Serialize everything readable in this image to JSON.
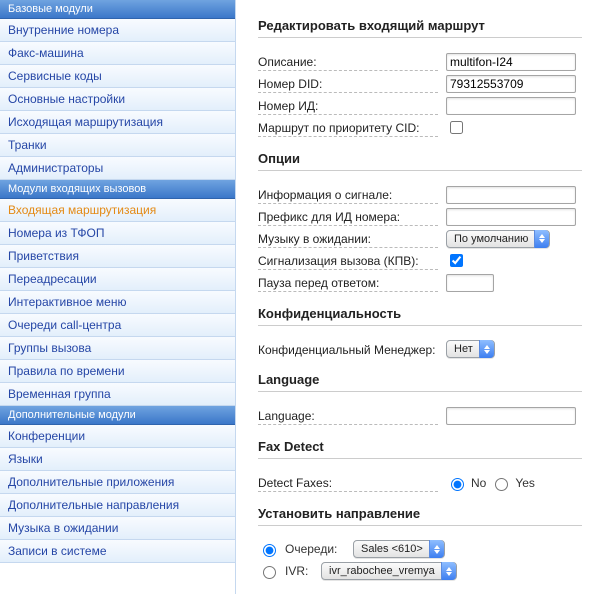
{
  "sidebar": {
    "groups": [
      {
        "header": "Базовые модули",
        "items": [
          {
            "name": "internal-numbers",
            "label": "Внутренние номера"
          },
          {
            "name": "fax-machine",
            "label": "Факс-машина"
          },
          {
            "name": "service-codes",
            "label": "Сервисные коды"
          },
          {
            "name": "main-settings",
            "label": "Основные настройки"
          },
          {
            "name": "outbound-routing",
            "label": "Исходящая маршрутизация"
          },
          {
            "name": "trunks",
            "label": "Транки"
          },
          {
            "name": "administrators",
            "label": "Администраторы"
          }
        ]
      },
      {
        "header": "Модули входящих вызовов",
        "items": [
          {
            "name": "inbound-routing",
            "label": "Входящая маршрутизация",
            "active": true
          },
          {
            "name": "pstn-numbers",
            "label": "Номера из ТФОП"
          },
          {
            "name": "greetings",
            "label": "Приветствия"
          },
          {
            "name": "call-forwarding",
            "label": "Переадресации"
          },
          {
            "name": "ivr-menu",
            "label": "Интерактивное меню"
          },
          {
            "name": "call-center-queues",
            "label": "Очереди call-центра"
          },
          {
            "name": "ring-groups",
            "label": "Группы вызова"
          },
          {
            "name": "time-conditions",
            "label": "Правила по времени"
          },
          {
            "name": "time-groups",
            "label": "Временная группа"
          }
        ]
      },
      {
        "header": "Дополнительные модули",
        "items": [
          {
            "name": "conferences",
            "label": "Конференции"
          },
          {
            "name": "languages",
            "label": "Языки"
          },
          {
            "name": "additional-apps",
            "label": "Дополнительные приложения"
          },
          {
            "name": "additional-destinations",
            "label": "Дополнительные направления"
          },
          {
            "name": "music-on-hold",
            "label": "Музыка в ожидании"
          },
          {
            "name": "system-recordings",
            "label": "Записи в системе"
          }
        ]
      }
    ]
  },
  "main": {
    "title": "Редактировать входящий маршрут",
    "sections": {
      "basic": [
        {
          "id": "description",
          "label": "Описание:",
          "value": "multifon-I24"
        },
        {
          "id": "did",
          "label": "Номер DID:",
          "value": "79312553709"
        },
        {
          "id": "cid",
          "label": "Номер ИД:",
          "value": ""
        }
      ],
      "cid_priority": {
        "label": "Маршрут по приоритету CID:",
        "checked": false
      },
      "options_title": "Опции",
      "options": [
        {
          "id": "alert-info",
          "label": "Информация о сигнале:",
          "value": ""
        },
        {
          "id": "cid-prefix",
          "label": "Префикс для ИД номера:",
          "value": ""
        }
      ],
      "moh": {
        "label": "Музыку в ожидании:",
        "value": "По умолчанию"
      },
      "ringing": {
        "label": "Сигнализация вызова (КПВ):",
        "checked": true
      },
      "pause": {
        "label": "Пауза перед ответом:",
        "value": ""
      },
      "privacy_title": "Конфиденциальность",
      "privacy": {
        "label": "Конфиденциальный Менеджер:",
        "value": "Нет"
      },
      "language_title": "Language",
      "language": {
        "label": "Language:",
        "value": ""
      },
      "fax_title": "Fax Detect",
      "fax": {
        "label": "Detect Faxes:",
        "no": "No",
        "yes": "Yes",
        "selected": "no"
      },
      "dest_title": "Установить направление",
      "destinations": [
        {
          "id": "queues",
          "label": "Очереди:",
          "value": "Sales <610>",
          "selected": true
        },
        {
          "id": "ivr",
          "label": "IVR:",
          "value": "ivr_rabochee_vremya",
          "selected": false
        }
      ]
    }
  }
}
